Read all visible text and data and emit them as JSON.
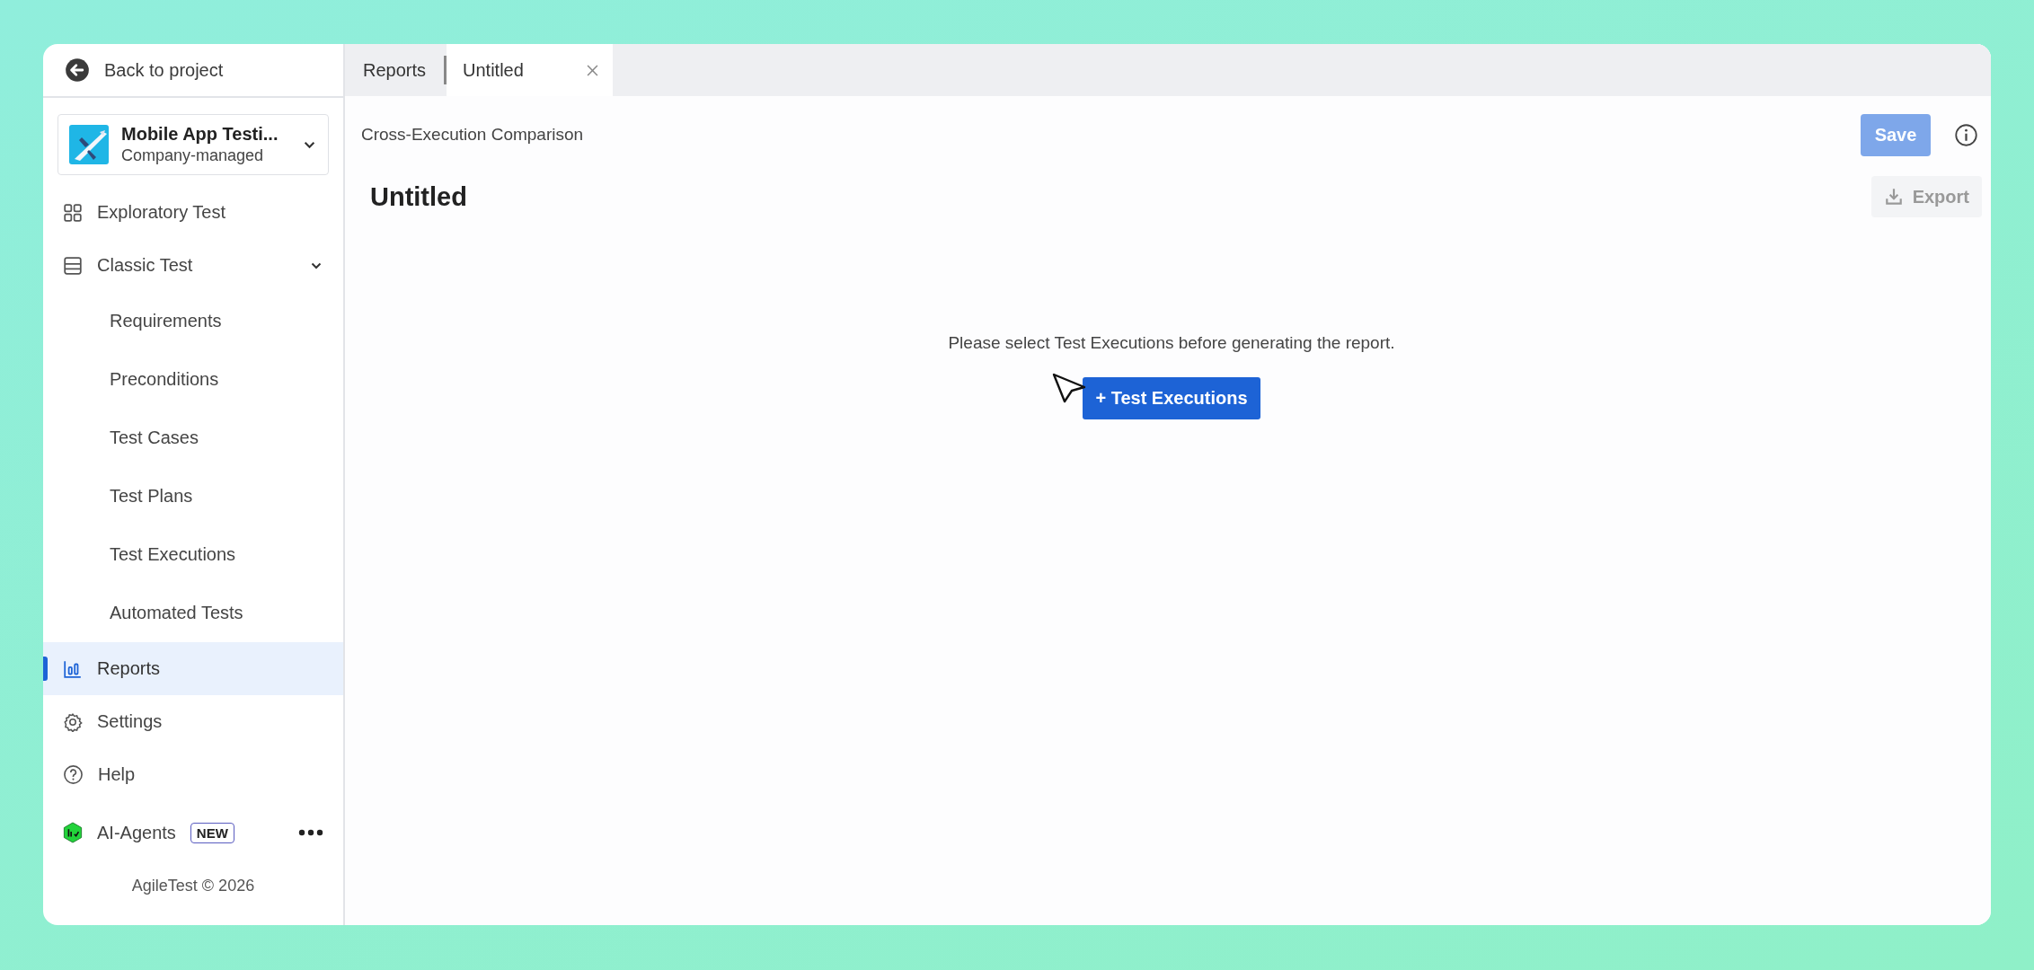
{
  "back_link": "Back to project",
  "project": {
    "name": "Mobile App Testi...",
    "type": "Company-managed"
  },
  "nav": [
    {
      "label": "Exploratory Test",
      "selected": false
    },
    {
      "label": "Classic Test",
      "selected": false,
      "expanded": true,
      "children": [
        {
          "label": "Requirements",
          "selected": false
        },
        {
          "label": "Preconditions",
          "selected": false
        },
        {
          "label": "Test Cases",
          "selected": false
        },
        {
          "label": "Test Plans",
          "selected": false
        },
        {
          "label": "Test Executions",
          "selected": false
        },
        {
          "label": "Automated Tests",
          "selected": false
        }
      ]
    },
    {
      "label": "Reports",
      "selected": true
    },
    {
      "label": "Settings",
      "selected": false
    },
    {
      "label": "Help",
      "selected": false
    }
  ],
  "ai_agents": {
    "label": "AI-Agents",
    "badge": "NEW"
  },
  "footer": "AgileTest © 2026",
  "tabs": [
    {
      "label": "Reports",
      "selected": false,
      "closable": false
    },
    {
      "label": "Untitled",
      "selected": true,
      "closable": true
    }
  ],
  "report_type": "Cross-Execution Comparison",
  "save_button": {
    "label": "Save",
    "disabled": true
  },
  "title": "Untitled",
  "export_button": {
    "label": "Export",
    "disabled": true
  },
  "empty_message": "Please select Test Executions before generating the report.",
  "add_button": "+ Test Executions"
}
